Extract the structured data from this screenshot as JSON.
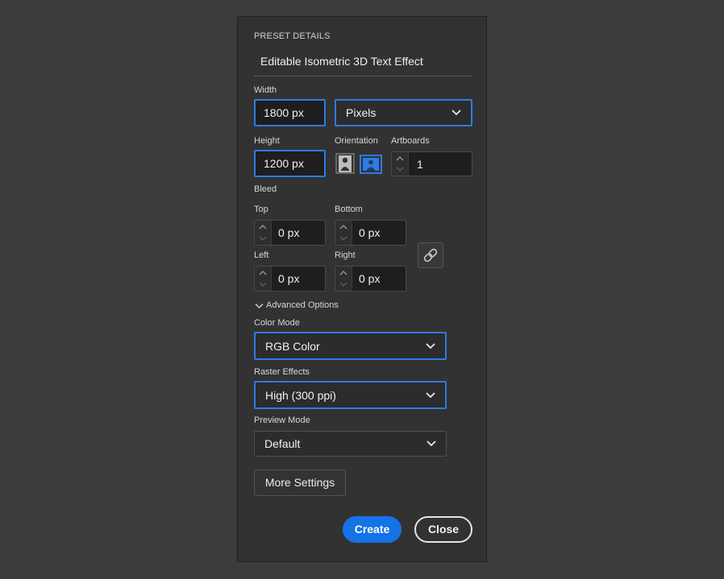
{
  "preset": {
    "header": "PRESET DETAILS",
    "name": "Editable Isometric 3D Text Effect"
  },
  "size": {
    "width_label": "Width",
    "width_value": "1800 px",
    "units_value": "Pixels",
    "height_label": "Height",
    "height_value": "1200 px",
    "orientation_label": "Orientation",
    "orientation_selected": "landscape",
    "artboards_label": "Artboards",
    "artboards_value": "1"
  },
  "bleed": {
    "label": "Bleed",
    "top_label": "Top",
    "top_value": "0 px",
    "bottom_label": "Bottom",
    "bottom_value": "0 px",
    "left_label": "Left",
    "left_value": "0 px",
    "right_label": "Right",
    "right_value": "0 px"
  },
  "advanced": {
    "toggle_label": "Advanced Options",
    "color_mode_label": "Color Mode",
    "color_mode_value": "RGB Color",
    "raster_label": "Raster Effects",
    "raster_value": "High (300 ppi)",
    "preview_label": "Preview Mode",
    "preview_value": "Default"
  },
  "buttons": {
    "more_settings": "More Settings",
    "create": "Create",
    "close": "Close"
  },
  "colors": {
    "accent": "#2d7be5",
    "create_bg": "#1473e6",
    "panel_bg": "#323232",
    "page_bg": "#3c3c3c"
  },
  "icons": [
    "chevron-down-icon",
    "portrait-icon",
    "landscape-icon",
    "link-icon",
    "stepper-up-icon",
    "stepper-down-icon"
  ]
}
